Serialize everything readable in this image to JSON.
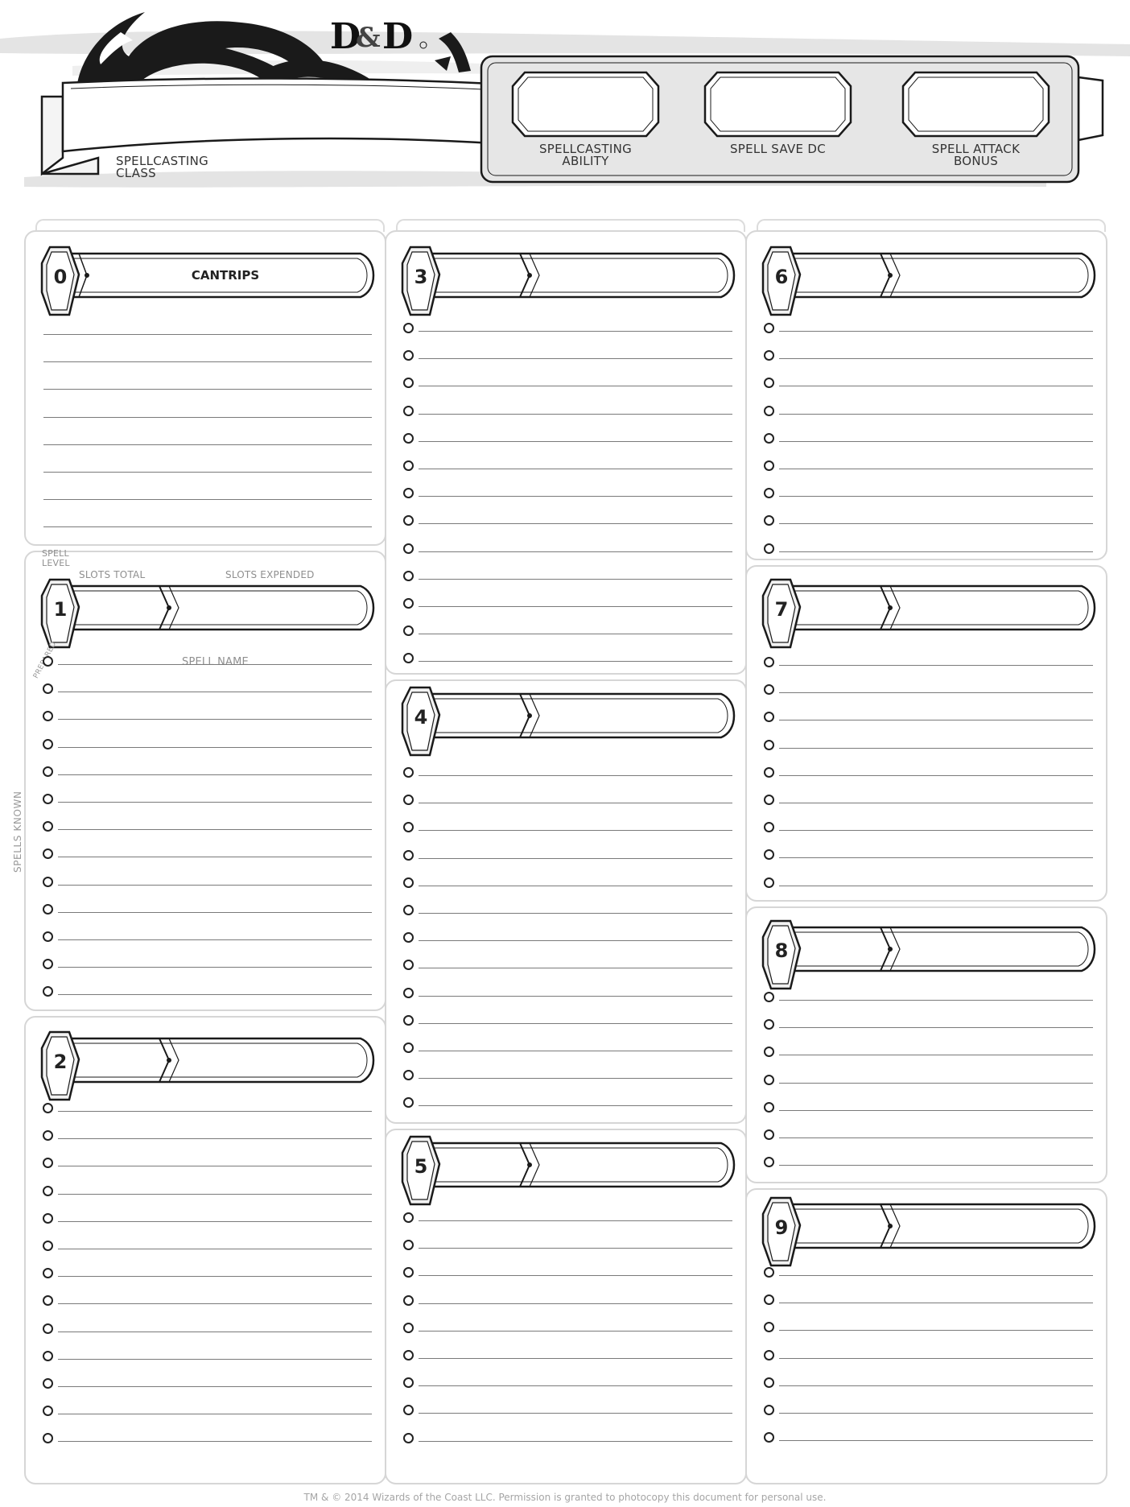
{
  "header": {
    "logo_text": "D&D",
    "spellcasting_class_label": "SPELLCASTING\nCLASS",
    "spellcasting_class_value": "",
    "fields": [
      {
        "label": "SPELLCASTING\nABILITY",
        "value": ""
      },
      {
        "label": "SPELL SAVE DC",
        "value": ""
      },
      {
        "label": "SPELL ATTACK\nBONUS",
        "value": ""
      }
    ]
  },
  "guide_labels": {
    "spell_level": "SPELL\nLEVEL",
    "slots_total": "SLOTS TOTAL",
    "slots_expended": "SLOTS EXPENDED",
    "prepared": "PREPARED",
    "spell_name": "SPELL NAME",
    "spells_known": "SPELLS KNOWN"
  },
  "levels": [
    {
      "number": "0",
      "title": "CANTRIPS",
      "lines": 8,
      "has_circles": false
    },
    {
      "number": "1",
      "title": "",
      "lines": 13,
      "has_circles": true
    },
    {
      "number": "2",
      "title": "",
      "lines": 13,
      "has_circles": true
    },
    {
      "number": "3",
      "title": "",
      "lines": 13,
      "has_circles": true
    },
    {
      "number": "4",
      "title": "",
      "lines": 13,
      "has_circles": true
    },
    {
      "number": "5",
      "title": "",
      "lines": 9,
      "has_circles": true
    },
    {
      "number": "6",
      "title": "",
      "lines": 9,
      "has_circles": true
    },
    {
      "number": "7",
      "title": "",
      "lines": 9,
      "has_circles": true
    },
    {
      "number": "8",
      "title": "",
      "lines": 7,
      "has_circles": true
    },
    {
      "number": "9",
      "title": "",
      "lines": 7,
      "has_circles": true
    }
  ],
  "footer": "TM & © 2014 Wizards of the Coast LLC. Permission is granted to photocopy this document for personal use."
}
